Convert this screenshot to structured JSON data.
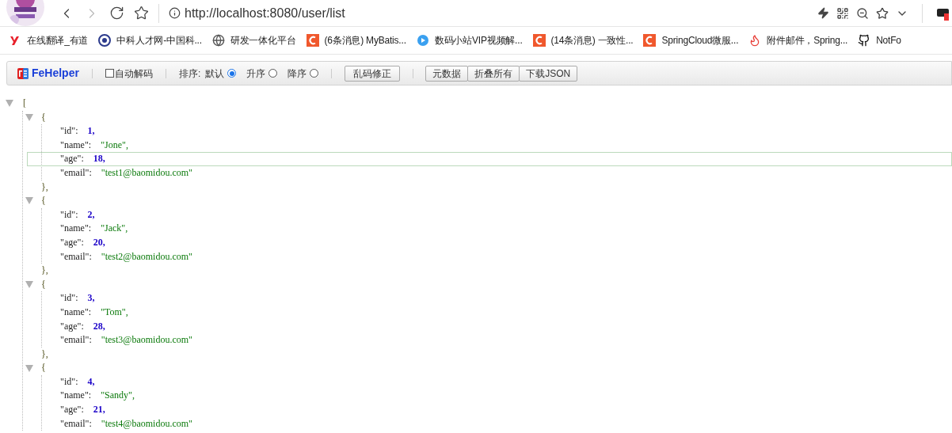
{
  "address_bar": {
    "url": "http://localhost:8080/user/list"
  },
  "bookmarks": [
    {
      "label": "在线翻译_有道",
      "kind": "youdao"
    },
    {
      "label": "中科人才网-中国科...",
      "kind": "seal"
    },
    {
      "label": "研发一体化平台",
      "kind": "globe"
    },
    {
      "label": "(6条消息) MyBatis...",
      "kind": "csdn"
    },
    {
      "label": "数码小站VIP视频解...",
      "kind": "play"
    },
    {
      "label": "(14条消息) 一致性...",
      "kind": "csdn"
    },
    {
      "label": "SpringCloud微服...",
      "kind": "csdn"
    },
    {
      "label": "附件邮件，Spring...",
      "kind": "flame"
    },
    {
      "label": "NotFo",
      "kind": "github"
    }
  ],
  "fehelper": {
    "title": "FeHelper",
    "auto_decode": {
      "label": "自动解码",
      "checked": false
    },
    "sort_label": "排序:",
    "sort_options": [
      {
        "label": "默认",
        "selected": true
      },
      {
        "label": "升序",
        "selected": false
      },
      {
        "label": "降序",
        "selected": false
      }
    ],
    "fix_button": "乱码修正",
    "buttons": [
      "元数据",
      "折叠所有",
      "下载JSON"
    ]
  },
  "json_view": {
    "open": "[",
    "expanded": true,
    "objects": [
      {
        "open": "{",
        "close": "},",
        "expanded": true,
        "fields": [
          {
            "key": "\"id\":",
            "value": "1,",
            "kind": "number",
            "highlighted": false
          },
          {
            "key": "\"name\":",
            "value": "\"Jone\",",
            "kind": "string",
            "highlighted": false
          },
          {
            "key": "\"age\":",
            "value": "18,",
            "kind": "number",
            "highlighted": true
          },
          {
            "key": "\"email\":",
            "value": "\"test1@baomidou.com\"",
            "kind": "string",
            "highlighted": false
          }
        ]
      },
      {
        "open": "{",
        "close": "},",
        "expanded": true,
        "fields": [
          {
            "key": "\"id\":",
            "value": "2,",
            "kind": "number",
            "highlighted": false
          },
          {
            "key": "\"name\":",
            "value": "\"Jack\",",
            "kind": "string",
            "highlighted": false
          },
          {
            "key": "\"age\":",
            "value": "20,",
            "kind": "number",
            "highlighted": false
          },
          {
            "key": "\"email\":",
            "value": "\"test2@baomidou.com\"",
            "kind": "string",
            "highlighted": false
          }
        ]
      },
      {
        "open": "{",
        "close": "},",
        "expanded": true,
        "fields": [
          {
            "key": "\"id\":",
            "value": "3,",
            "kind": "number",
            "highlighted": false
          },
          {
            "key": "\"name\":",
            "value": "\"Tom\",",
            "kind": "string",
            "highlighted": false
          },
          {
            "key": "\"age\":",
            "value": "28,",
            "kind": "number",
            "highlighted": false
          },
          {
            "key": "\"email\":",
            "value": "\"test3@baomidou.com\"",
            "kind": "string",
            "highlighted": false
          }
        ]
      },
      {
        "open": "{",
        "expanded": true,
        "fields": [
          {
            "key": "\"id\":",
            "value": "4,",
            "kind": "number",
            "highlighted": false
          },
          {
            "key": "\"name\":",
            "value": "\"Sandy\",",
            "kind": "string",
            "highlighted": false
          },
          {
            "key": "\"age\":",
            "value": "21,",
            "kind": "number",
            "highlighted": false
          },
          {
            "key": "\"email\":",
            "value": "\"test4@baomidou.com\"",
            "kind": "string",
            "highlighted": false
          }
        ]
      }
    ]
  }
}
